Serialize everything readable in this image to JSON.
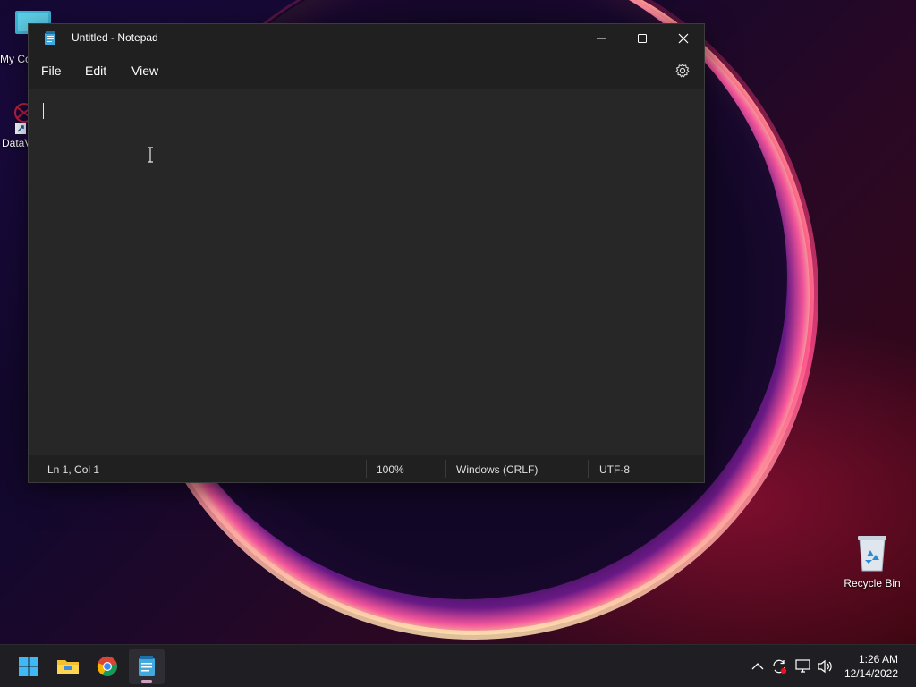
{
  "desktop": {
    "icons": [
      {
        "label": "My Co"
      },
      {
        "label": "DataV"
      },
      {
        "label": "Recycle Bin"
      }
    ]
  },
  "notepad": {
    "title": "Untitled - Notepad",
    "menu": {
      "file": "File",
      "edit": "Edit",
      "view": "View"
    },
    "document_text": "",
    "status": {
      "position": "Ln 1, Col 1",
      "zoom": "100%",
      "line_ending": "Windows (CRLF)",
      "encoding": "UTF-8"
    }
  },
  "taskbar": {
    "apps": [
      {
        "icon": "windows-start-icon"
      },
      {
        "icon": "file-explorer-icon"
      },
      {
        "icon": "chrome-icon"
      },
      {
        "icon": "notepad-icon",
        "active": true
      }
    ],
    "tray": {
      "time": "1:26 AM",
      "date": "12/14/2022"
    }
  },
  "colors": {
    "window_bg": "#272727",
    "titlebar_bg": "#202020",
    "taskbar_bg": "#1f1f23"
  }
}
